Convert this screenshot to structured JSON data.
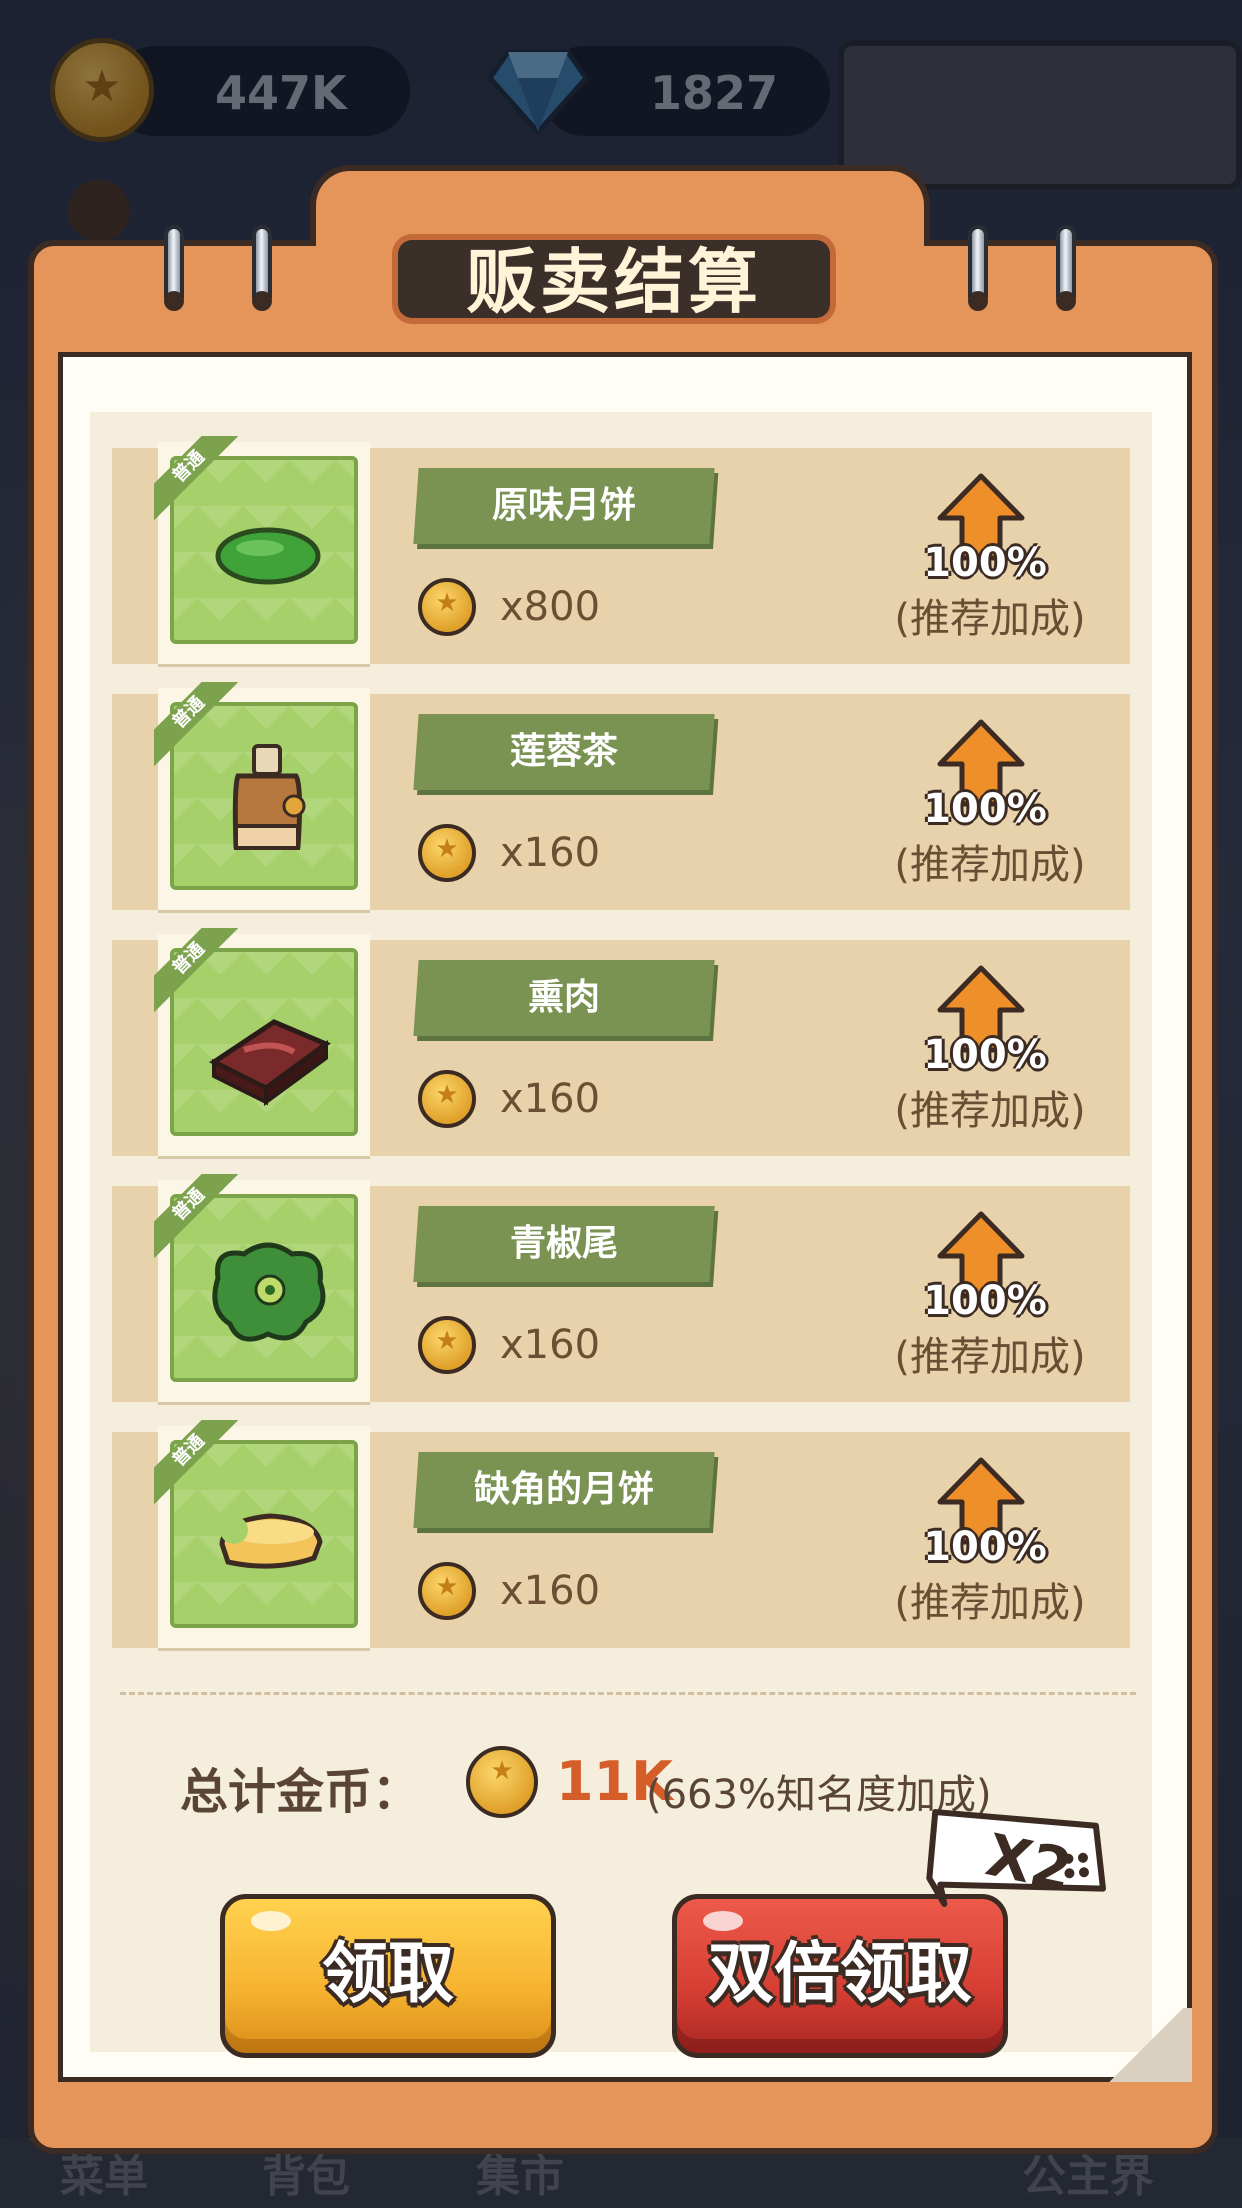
{
  "topbar": {
    "coins": "447K",
    "gems": "1827"
  },
  "bottom_nav": [
    "菜单",
    "背包",
    "集市",
    "公主界"
  ],
  "dialog": {
    "title": "贩卖结算",
    "rarity_label": "普通",
    "items": [
      {
        "name": "原味月饼",
        "qty": "x800",
        "bonus_pct": "100%",
        "bonus_label": "(推荐加成)",
        "icon": "green-mooncake-icon"
      },
      {
        "name": "莲蓉茶",
        "qty": "x160",
        "bonus_pct": "100%",
        "bonus_label": "(推荐加成)",
        "icon": "tea-bottle-icon"
      },
      {
        "name": "熏肉",
        "qty": "x160",
        "bonus_pct": "100%",
        "bonus_label": "(推荐加成)",
        "icon": "smoked-meat-icon"
      },
      {
        "name": "青椒尾",
        "qty": "x160",
        "bonus_pct": "100%",
        "bonus_label": "(推荐加成)",
        "icon": "green-pepper-icon"
      },
      {
        "name": "缺角的月饼",
        "qty": "x160",
        "bonus_pct": "100%",
        "bonus_label": "(推荐加成)",
        "icon": "bitten-mooncake-icon"
      }
    ],
    "total": {
      "label": "总计金币：",
      "value": "11K",
      "bonus": "(663%知名度加成)"
    },
    "buttons": {
      "claim": "领取",
      "double_claim": "双倍领取",
      "x2_tag": "X2"
    }
  },
  "colors": {
    "accent_orange": "#e6955a",
    "row_bg": "#e7d2ac",
    "name_plate": "#7a9352",
    "total_value": "#d55d2a"
  }
}
